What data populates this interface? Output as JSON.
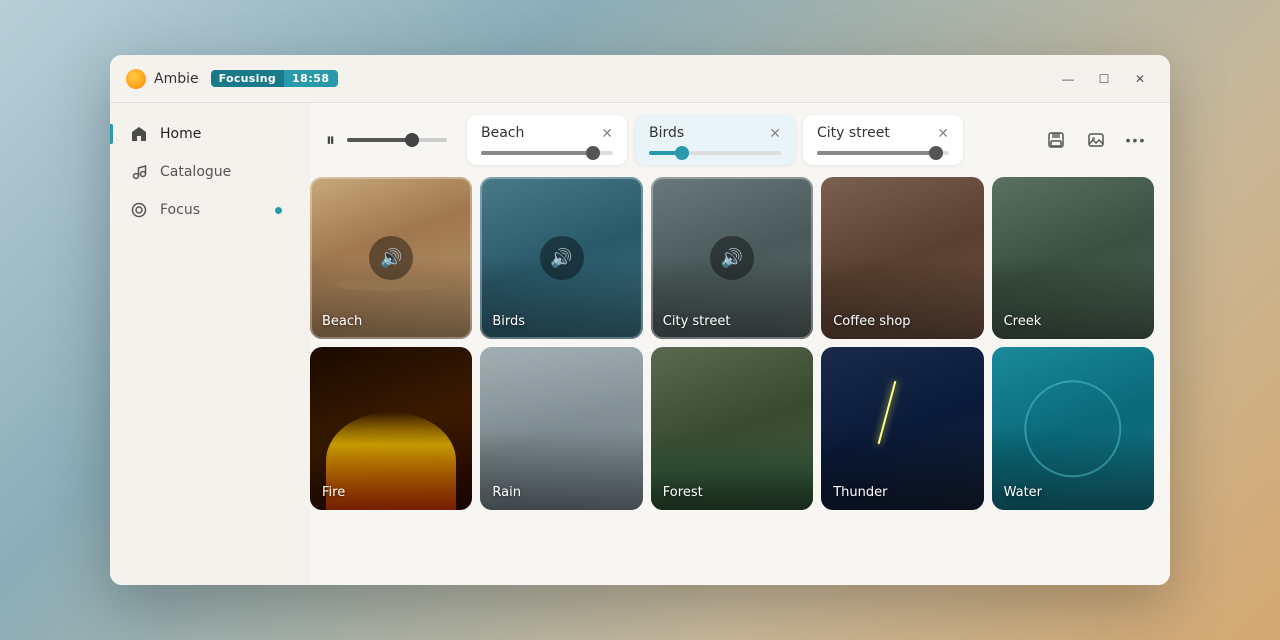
{
  "app": {
    "name": "Ambie",
    "icon": "sun-icon",
    "badge_label": "Focusing",
    "timer": "18:58"
  },
  "window_controls": {
    "minimize": "—",
    "maximize": "☐",
    "close": "✕"
  },
  "sidebar": {
    "items": [
      {
        "id": "home",
        "label": "Home",
        "icon": "home-icon",
        "active": true
      },
      {
        "id": "catalogue",
        "label": "Catalogue",
        "icon": "music-icon",
        "active": false
      },
      {
        "id": "focus",
        "label": "Focus",
        "icon": "focus-icon",
        "active": false,
        "has_dot": true
      }
    ]
  },
  "controls": {
    "play_pause_icon": "⏸",
    "master_volume": 65,
    "active_cards": [
      {
        "id": "beach",
        "label": "Beach",
        "volume": 85,
        "variant": "beach"
      },
      {
        "id": "birds",
        "label": "Birds",
        "volume": 25,
        "variant": "birds"
      },
      {
        "id": "citystreet",
        "label": "City street",
        "volume": 90,
        "variant": "citystreet"
      }
    ],
    "toolbar": {
      "save_icon": "💾",
      "image_icon": "🖼",
      "more_icon": "···"
    }
  },
  "grid": {
    "cards": [
      {
        "id": "beach",
        "label": "Beach",
        "bg": "bg-beach",
        "playing": true
      },
      {
        "id": "birds",
        "label": "Birds",
        "bg": "bg-birds",
        "playing": true
      },
      {
        "id": "citystreet",
        "label": "City street",
        "bg": "bg-citystreet",
        "playing": true
      },
      {
        "id": "coffeeshop",
        "label": "Coffee shop",
        "bg": "bg-coffeeshop",
        "playing": false
      },
      {
        "id": "creek",
        "label": "Creek",
        "bg": "bg-creek",
        "playing": false
      },
      {
        "id": "fire",
        "label": "Fire",
        "bg": "bg-fire",
        "playing": false
      },
      {
        "id": "rain",
        "label": "Rain",
        "bg": "bg-rain",
        "playing": false
      },
      {
        "id": "forest",
        "label": "Forest",
        "bg": "bg-forest",
        "playing": false
      },
      {
        "id": "thunder",
        "label": "Thunder",
        "bg": "bg-thunder",
        "playing": false
      },
      {
        "id": "water",
        "label": "Water",
        "bg": "bg-water",
        "playing": false
      }
    ]
  }
}
